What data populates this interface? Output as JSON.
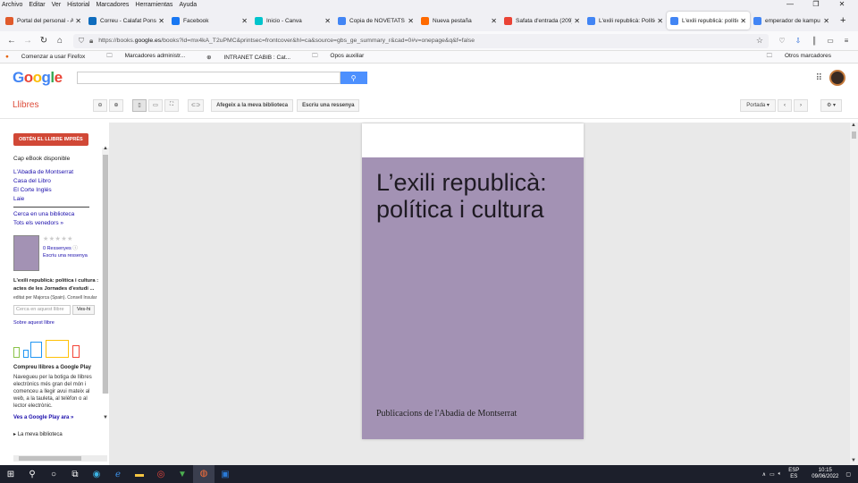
{
  "menubar": {
    "items": [
      "Archivo",
      "Editar",
      "Ver",
      "Historial",
      "Marcadores",
      "Herramientas",
      "Ayuda"
    ]
  },
  "tabs": [
    {
      "title": "Portal del personal - Ajuntament",
      "color": "#e05a2b",
      "active": false
    },
    {
      "title": "Correu - Calafat Ponseti",
      "color": "#0f6cbd",
      "active": false
    },
    {
      "title": "Facebook",
      "color": "#1877f2",
      "active": false
    },
    {
      "title": "Inicio - Canva",
      "color": "#00c4cc",
      "active": false
    },
    {
      "title": "Copia de NOVETATS Pri",
      "color": "#4285f4",
      "active": false
    },
    {
      "title": "Nueva pestaña",
      "color": "#ff6a00",
      "active": false
    },
    {
      "title": "Safata d'entrada (209) - ",
      "color": "#ea4335",
      "active": false
    },
    {
      "title": "L'exili republicà: Política",
      "color": "#4285f4",
      "active": false
    },
    {
      "title": "L'exili republicà: política",
      "color": "#4285f4",
      "active": true
    },
    {
      "title": "emperador de kampu - ",
      "color": "#4285f4",
      "active": false
    }
  ],
  "address": {
    "prefix": "https://books.",
    "domain": "google.es",
    "path": "/books?id=mx4kA_T2uPMC&printsec=frontcover&hl=ca&source=gbs_ge_summary_r&cad=0#v=onepage&q&f=false"
  },
  "bookmarks": {
    "items": [
      "Comenzar a usar Firefox",
      "Marcadores administr...",
      "INTRANET CABIB : Cat...",
      "Opos auxiliar"
    ],
    "other": "Otros marcadores"
  },
  "google": {
    "logo": [
      "G",
      "o",
      "o",
      "g",
      "l",
      "e"
    ]
  },
  "toolbar": {
    "section": "Llibres",
    "add_library": "Afegeix a la meva biblioteca",
    "write_review": "Escriu una ressenya",
    "portada": "Portada"
  },
  "sidebar": {
    "buy_button": "OBTÉN EL LLIBRE IMPRÈS",
    "no_ebook": "Cap eBook disponible",
    "stores": [
      "L'Abadia de Montserrat",
      "Casa del Libro",
      "El Corte Inglés",
      "Laie"
    ],
    "library_search": "Cerca en una biblioteca",
    "all_sellers": "Tots els venedors »",
    "stars": "★★★★★",
    "reviews": "0 Ressenyes",
    "write_review": "Escriu una ressenya",
    "book_title": "L'exili republicà: política i cultura : actes de les Jornades d'estudi ...",
    "author": "editat per Majorca (Spain). Consell Insular",
    "search_placeholder": "Cerca en aquest llibre",
    "search_go": "Ves-hi",
    "about": "Sobre aquest llibre",
    "play_heading": "Compreu llibres a Google Play",
    "play_text": "Navegueu per la botiga de llibres electrònics més gran del món i comenceu a llegir avui mateix al web, a la tauleta, al telèfon o al lector electrònic.",
    "play_link": "Ves a Google Play ara »",
    "my_library": "La meva biblioteca"
  },
  "book": {
    "title_line1": "L’exili republicà:",
    "title_line2": "política i cultura",
    "publisher": "Publicacions de l'Abadia de Montserrat",
    "cover_color": "#a392b4"
  },
  "taskbar": {
    "lang_top": "ESP",
    "lang_bottom": "ES",
    "time": "10:15",
    "date": "09/06/2022"
  }
}
